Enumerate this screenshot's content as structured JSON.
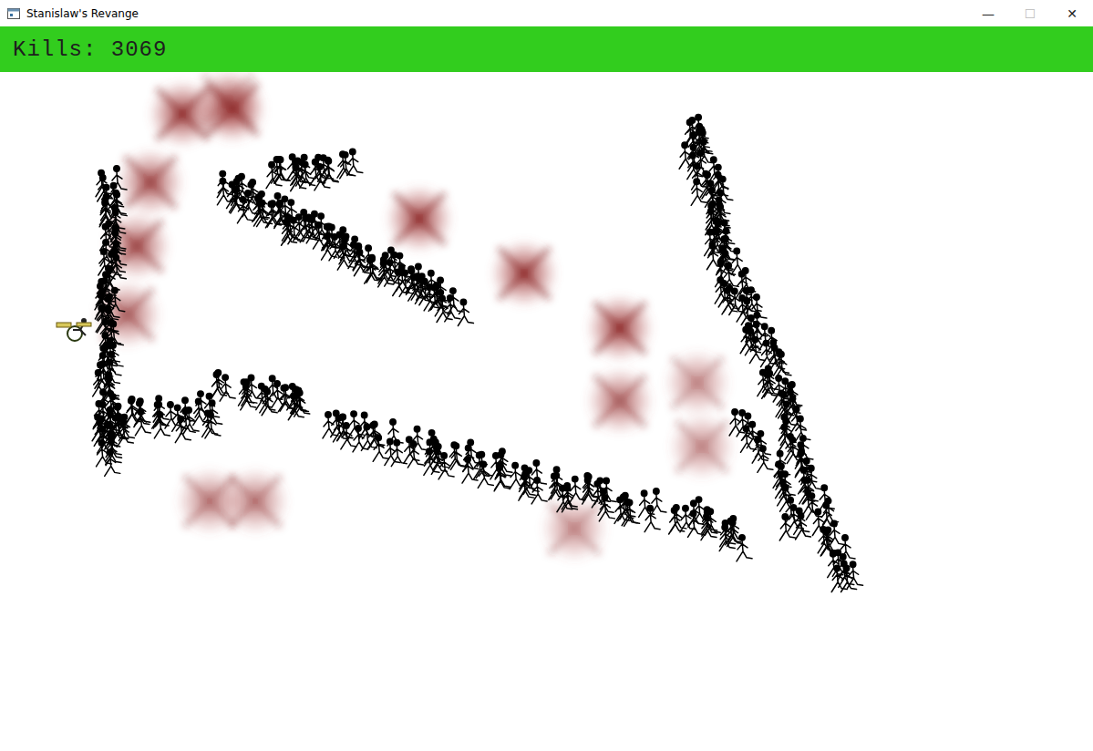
{
  "window": {
    "title": "Stanislaw's Revange",
    "controls": [
      {
        "glyph": "—",
        "disabled": false
      },
      {
        "glyph": "☐",
        "disabled": true
      },
      {
        "glyph": "✕",
        "disabled": false
      }
    ]
  },
  "hud": {
    "kills": "Kills: 3069"
  }
}
